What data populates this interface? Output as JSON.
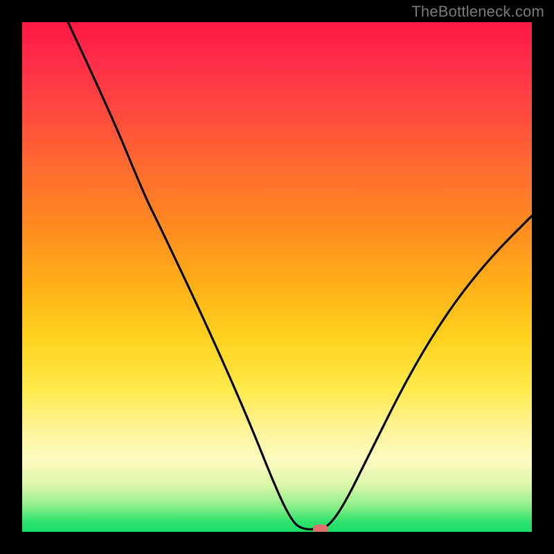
{
  "watermark": "TheBottleneck.com",
  "colors": {
    "frame_bg": "#000000",
    "curve_stroke": "#000000",
    "marker_fill": "#e0736e",
    "gradient_stops": [
      "#ff1744",
      "#ff2e4a",
      "#ff4a3e",
      "#ff6a30",
      "#ff8a20",
      "#ffb118",
      "#ffd21e",
      "#ffe94a",
      "#fff49a",
      "#fcfbc0",
      "#d9f7a9",
      "#8bef88",
      "#2fe36e",
      "#19dd66"
    ]
  },
  "chart_data": {
    "type": "line",
    "title": "",
    "xlabel": "",
    "ylabel": "",
    "xlim": [
      0,
      100
    ],
    "ylim": [
      0,
      100
    ],
    "grid": false,
    "legend": false,
    "curve": [
      {
        "x": 9,
        "y": 100
      },
      {
        "x": 17,
        "y": 83
      },
      {
        "x": 24,
        "y": 66
      },
      {
        "x": 27,
        "y": 60
      },
      {
        "x": 36,
        "y": 41
      },
      {
        "x": 44,
        "y": 23
      },
      {
        "x": 50,
        "y": 8
      },
      {
        "x": 53,
        "y": 2
      },
      {
        "x": 55,
        "y": 0.5
      },
      {
        "x": 58,
        "y": 0.5
      },
      {
        "x": 60,
        "y": 1
      },
      {
        "x": 63,
        "y": 5
      },
      {
        "x": 68,
        "y": 15
      },
      {
        "x": 76,
        "y": 31
      },
      {
        "x": 84,
        "y": 44
      },
      {
        "x": 92,
        "y": 54
      },
      {
        "x": 100,
        "y": 62
      }
    ],
    "marker": {
      "x": 58.5,
      "y": 0.5
    }
  }
}
